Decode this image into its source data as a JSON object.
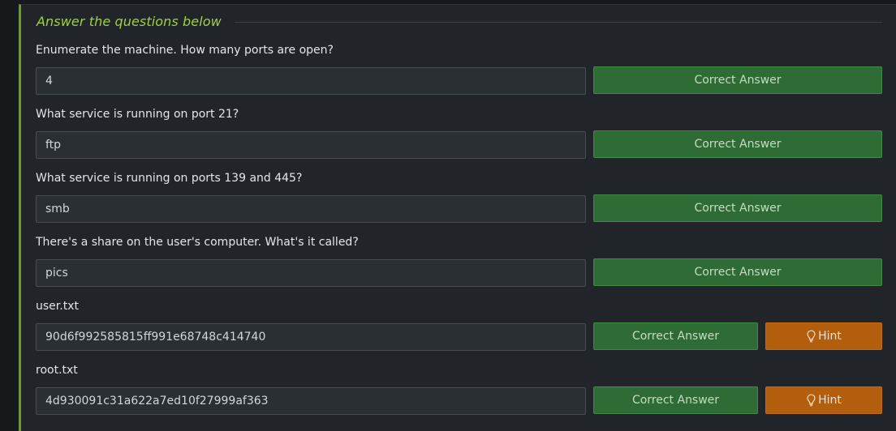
{
  "section": {
    "title": "Answer the questions below"
  },
  "questions": [
    {
      "label": "Enumerate the machine.  How many ports are open?",
      "answer": "4",
      "button": "Correct Answer"
    },
    {
      "label": "What service is running on port 21?",
      "answer": "ftp",
      "button": "Correct Answer"
    },
    {
      "label": "What service is running on ports 139 and 445?",
      "answer": "smb",
      "button": "Correct Answer"
    },
    {
      "label": "There's a share on the user's computer.  What's it called?",
      "answer": "pics",
      "button": "Correct Answer"
    },
    {
      "label": "user.txt",
      "answer": "90d6f992585815ff991e68748c414740",
      "button": "Correct Answer",
      "hint": "Hint"
    },
    {
      "label": "root.txt",
      "answer": "4d930091c31a622a7ed10f27999af363",
      "button": "Correct Answer",
      "hint": "Hint"
    }
  ],
  "colors": {
    "accent": "#9fd33a",
    "correct": "#2f6b34",
    "hint": "#b35e0d"
  },
  "icons": {
    "hint": "lightbulb-icon"
  }
}
